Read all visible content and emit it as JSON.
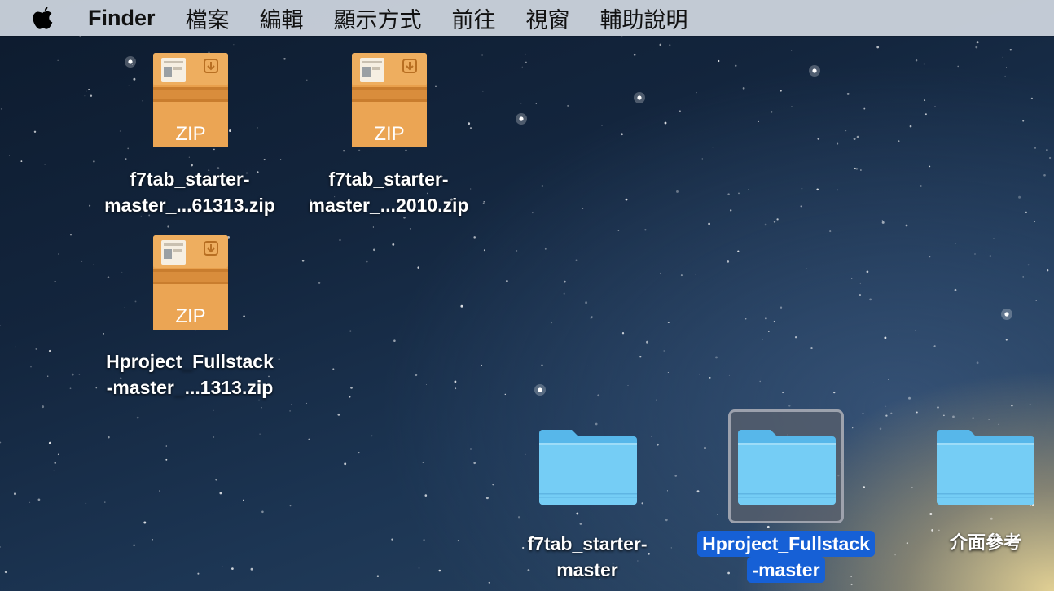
{
  "menubar": {
    "app_name": "Finder",
    "items": [
      "檔案",
      "編輯",
      "顯示方式",
      "前往",
      "視窗",
      "輔助說明"
    ]
  },
  "desktop": {
    "zip_badge": "ZIP",
    "files": [
      {
        "line1": "f7tab_starter-",
        "line2": "master_...61313.zip"
      },
      {
        "line1": "f7tab_starter-",
        "line2": "master_...2010.zip"
      },
      {
        "line1": "Hproject_Fullstack",
        "line2": "-master_...1313.zip"
      }
    ],
    "folders": [
      {
        "line1": "f7tab_starter-",
        "line2": "master",
        "selected": false
      },
      {
        "line1": "Hproject_Fullstack",
        "line2": "-master",
        "selected": true
      },
      {
        "line1": "介面參考",
        "line2": "",
        "selected": false
      }
    ]
  },
  "colors": {
    "selection": "#1660d6",
    "folder": "#6cc4f2",
    "zip": "#e9a04c"
  }
}
